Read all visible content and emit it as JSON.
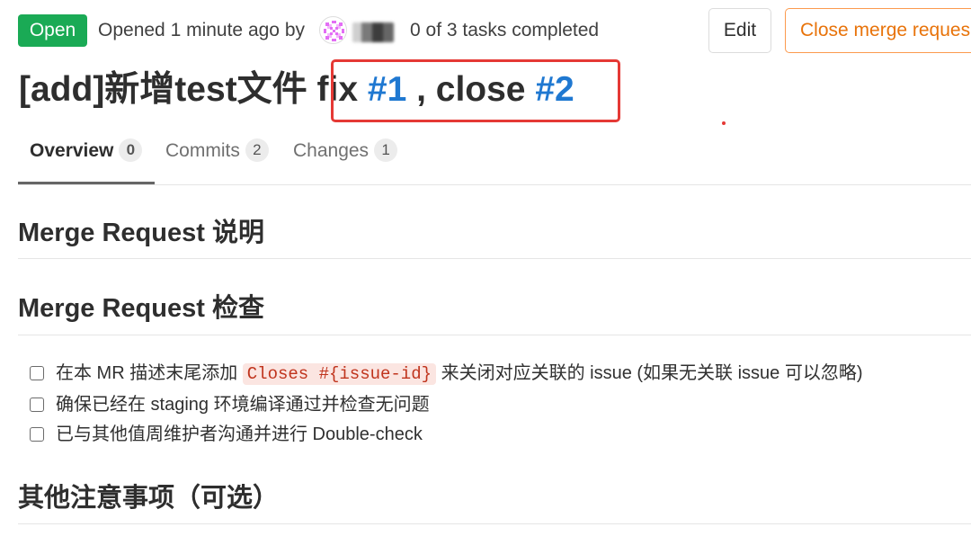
{
  "header": {
    "status": "Open",
    "opened_text": "Opened 1 minute ago by",
    "tasks_text": "0 of 3 tasks completed",
    "edit_label": "Edit",
    "close_label": "Close merge reques",
    "colors": {
      "status": "#1aaa55",
      "close": "#e8730a",
      "link": "#1f78d1",
      "highlight": "#e53935"
    }
  },
  "title": {
    "prefix": "[add]新增test文件 ",
    "fix_word": "fix ",
    "ref1": "#1",
    "middle": " , close ",
    "ref2": "#2"
  },
  "tabs": [
    {
      "label": "Overview",
      "count": "0"
    },
    {
      "label": "Commits",
      "count": "2"
    },
    {
      "label": "Changes",
      "count": "1"
    }
  ],
  "sections": {
    "desc_title": "Merge Request 说明",
    "check_title": "Merge Request 检查",
    "other_title": "其他注意事项（可选）"
  },
  "checklist": [
    {
      "before": "在本 MR 描述末尾添加 ",
      "code": "Closes #{issue-id}",
      "after": " 来关闭对应关联的 issue (如果无关联 issue 可以忽略)"
    },
    {
      "before": "确保已经在 staging 环境编译通过并检查无问题"
    },
    {
      "before": "已与其他值周维护者沟通并进行 Double-check"
    }
  ],
  "icons": {
    "avatar": "identicon-avatar"
  }
}
